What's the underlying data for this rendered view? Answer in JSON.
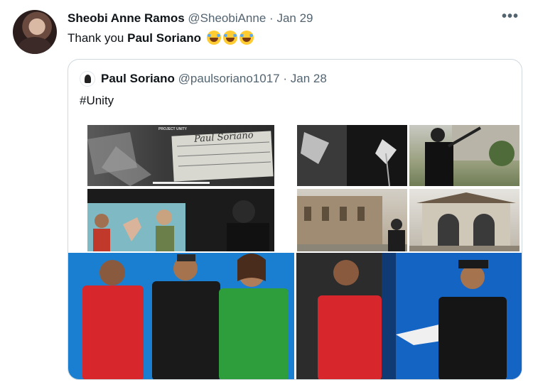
{
  "tweet": {
    "author_name": "Sheobi Anne Ramos",
    "author_handle": "@SheobiAnne",
    "separator": "·",
    "date": "Jan 29",
    "text_prefix": "Thank you ",
    "mention": "Paul Soriano",
    "more_icon": "•••"
  },
  "quote": {
    "author_name": "Paul Soriano",
    "author_handle": "@paulsoriano1017",
    "separator": "·",
    "date": "Jan 28",
    "text": "#Unity"
  },
  "media": {
    "clapboard_text": "Paul Soriano",
    "clapboard_project": "PROJECT UNITY"
  }
}
